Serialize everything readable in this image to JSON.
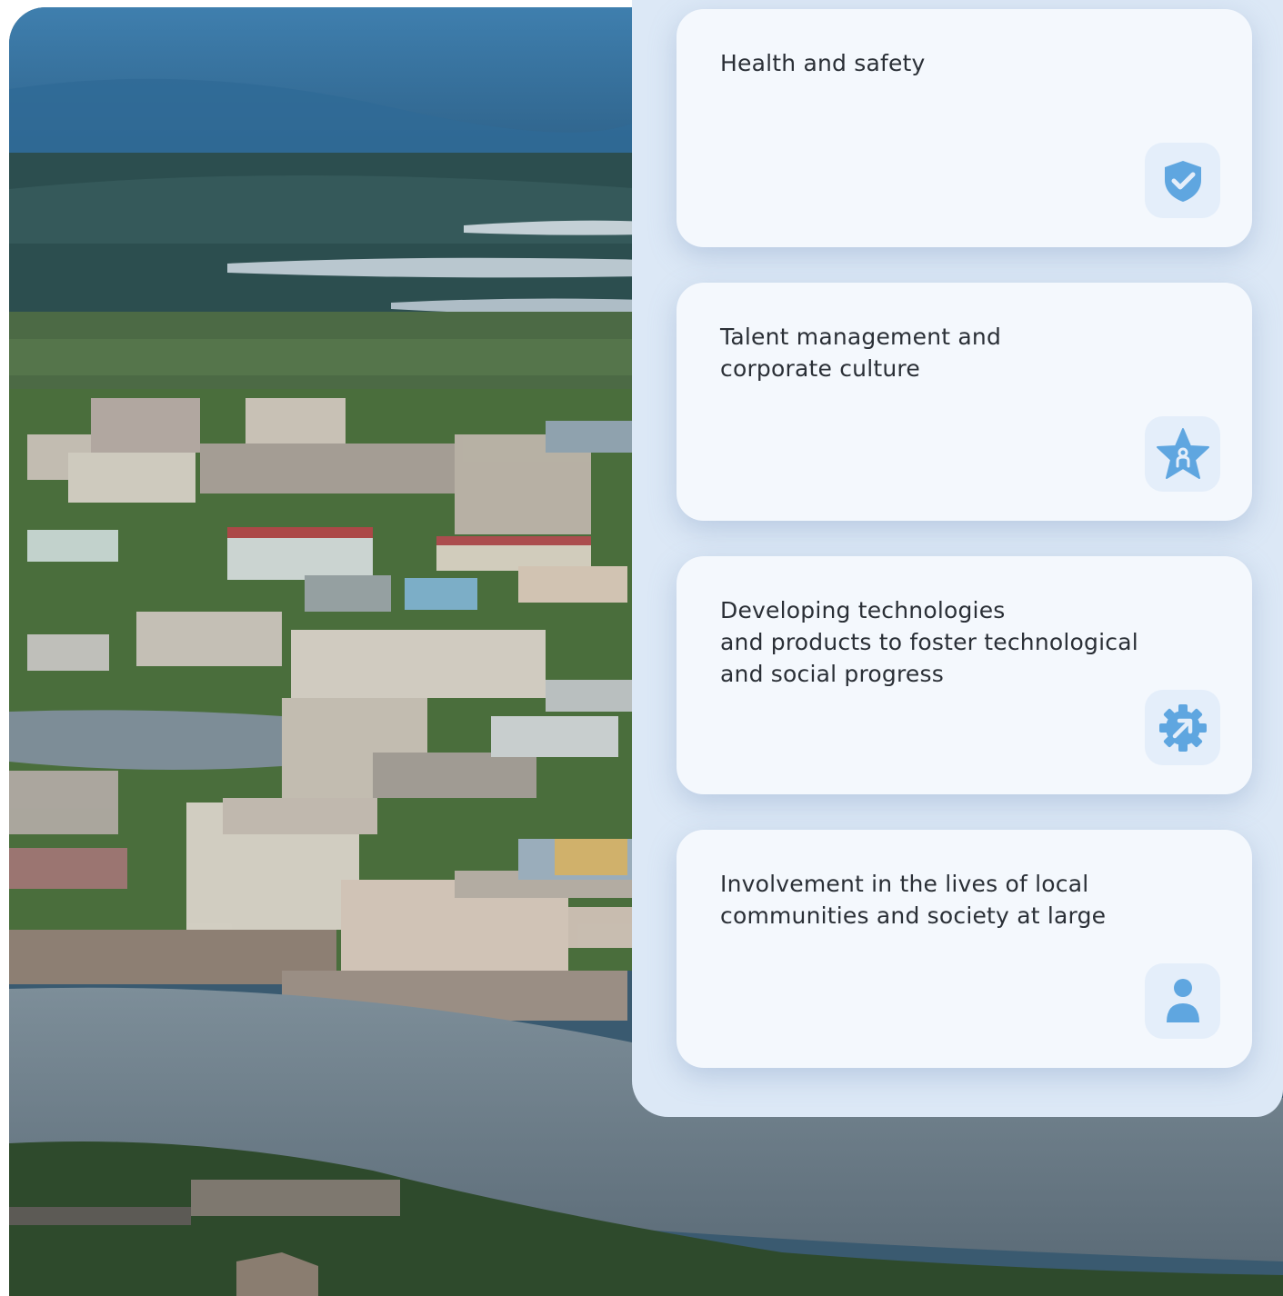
{
  "colors": {
    "panel_bg": "#dce8f6",
    "card_bg": "#f4f8fd",
    "icon_tile_bg": "#e4eefa",
    "icon_color": "#5fa6e0",
    "text_color": "#2a2f36"
  },
  "cards": [
    {
      "title": "Health and safety",
      "icon": "shield-check-icon"
    },
    {
      "title": "Talent management and\ncorporate culture",
      "icon": "star-person-icon"
    },
    {
      "title": "Developing technologies\nand products to foster technological\nand social progress",
      "icon": "gear-arrow-icon"
    },
    {
      "title": "Involvement in the lives of local\ncommunities and society at large",
      "icon": "person-icon"
    }
  ]
}
